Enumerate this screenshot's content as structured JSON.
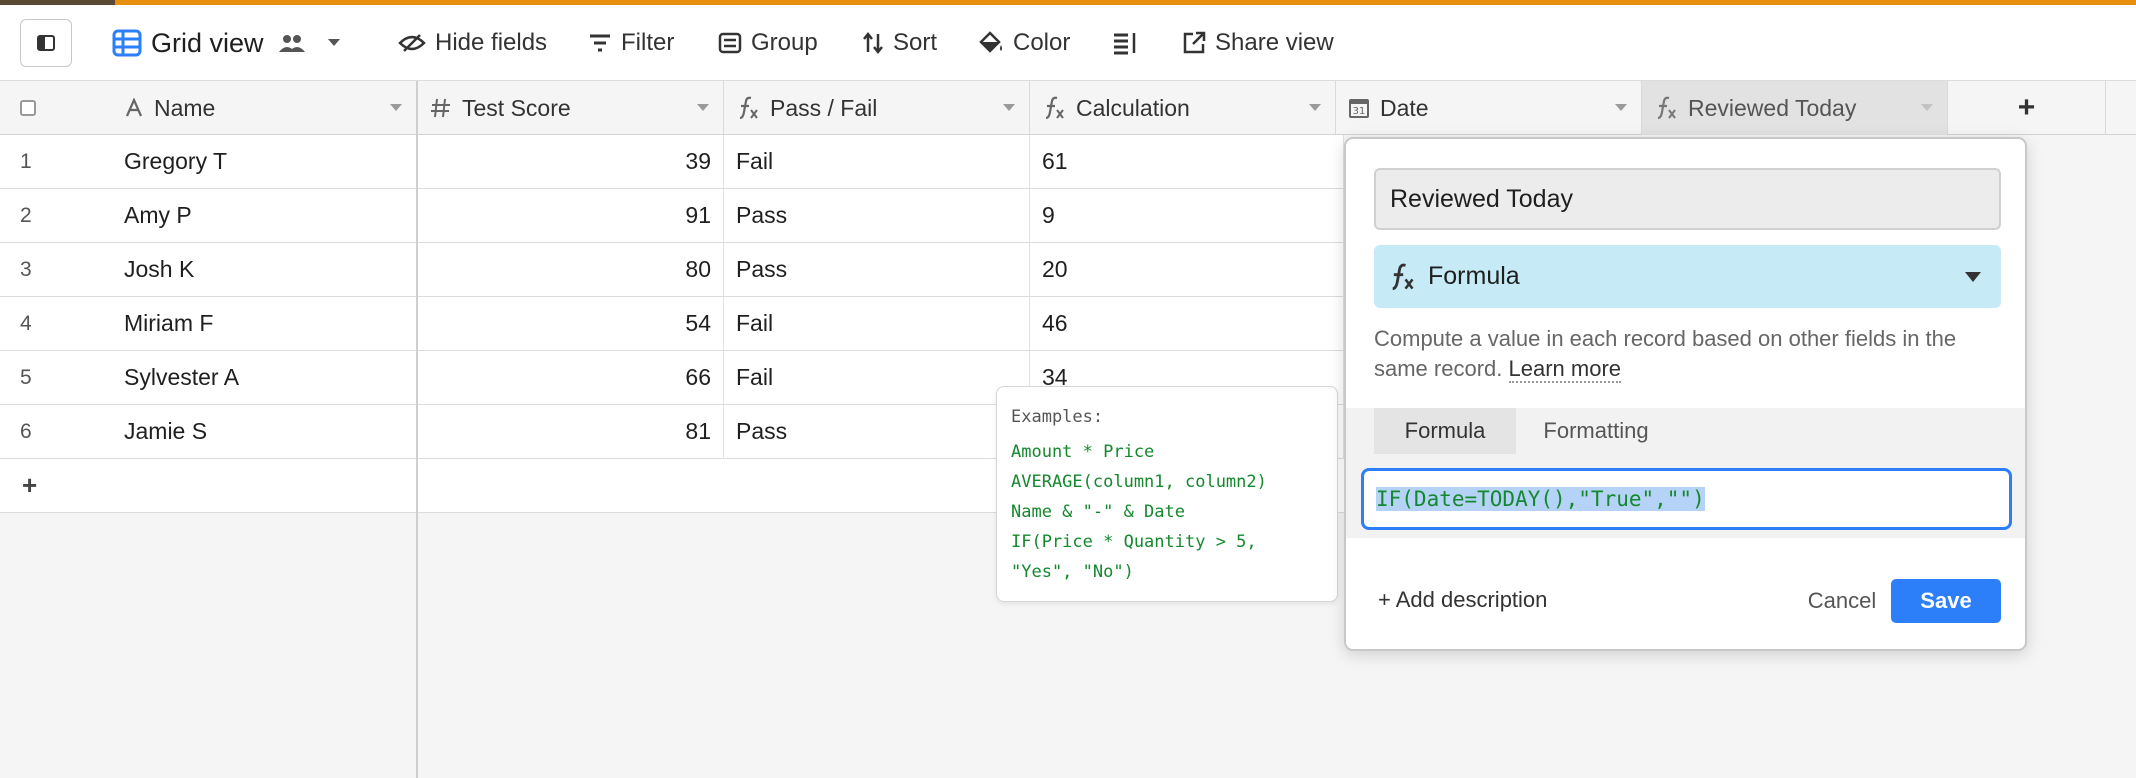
{
  "toolbar": {
    "view_name": "Grid view",
    "hide_fields": "Hide fields",
    "filter": "Filter",
    "group": "Group",
    "sort": "Sort",
    "color": "Color",
    "share_view": "Share view"
  },
  "columns": [
    {
      "label": "Name",
      "icon": "text-icon"
    },
    {
      "label": "Test Score",
      "icon": "number-icon"
    },
    {
      "label": "Pass / Fail",
      "icon": "formula-icon"
    },
    {
      "label": "Calculation",
      "icon": "formula-icon"
    },
    {
      "label": "Date",
      "icon": "calendar-icon"
    },
    {
      "label": "Reviewed Today",
      "icon": "formula-icon"
    }
  ],
  "add_column_label": "+",
  "rows": [
    {
      "num": "1",
      "name": "Gregory T",
      "score": "39",
      "pass": "Fail",
      "calc": "61"
    },
    {
      "num": "2",
      "name": "Amy P",
      "score": "91",
      "pass": "Pass",
      "calc": "9"
    },
    {
      "num": "3",
      "name": "Josh K",
      "score": "80",
      "pass": "Pass",
      "calc": "20"
    },
    {
      "num": "4",
      "name": "Miriam F",
      "score": "54",
      "pass": "Fail",
      "calc": "46"
    },
    {
      "num": "5",
      "name": "Sylvester A",
      "score": "66",
      "pass": "Fail",
      "calc": "34"
    },
    {
      "num": "6",
      "name": "Jamie S",
      "score": "81",
      "pass": "Pass",
      "calc": ""
    }
  ],
  "add_row_label": "+",
  "examples": {
    "title": "Examples:",
    "items": [
      "Amount * Price",
      "AVERAGE(column1, column2)",
      "Name & \"-\" & Date",
      "IF(Price * Quantity > 5,",
      "\"Yes\", \"No\")"
    ]
  },
  "editor": {
    "field_name": "Reviewed Today",
    "field_type": "Formula",
    "description": "Compute a value in each record based on other fields in the same record.",
    "learn_more": "Learn more",
    "tabs": [
      "Formula",
      "Formatting"
    ],
    "formula": "IF(Date=TODAY(),\"True\",\"\")",
    "add_description": "+ Add description",
    "cancel": "Cancel",
    "save": "Save"
  },
  "colors": {
    "accent": "#e8900d",
    "primary": "#2d7ff9",
    "formula_green": "#14882e",
    "type_bg": "#c6ebf6"
  }
}
